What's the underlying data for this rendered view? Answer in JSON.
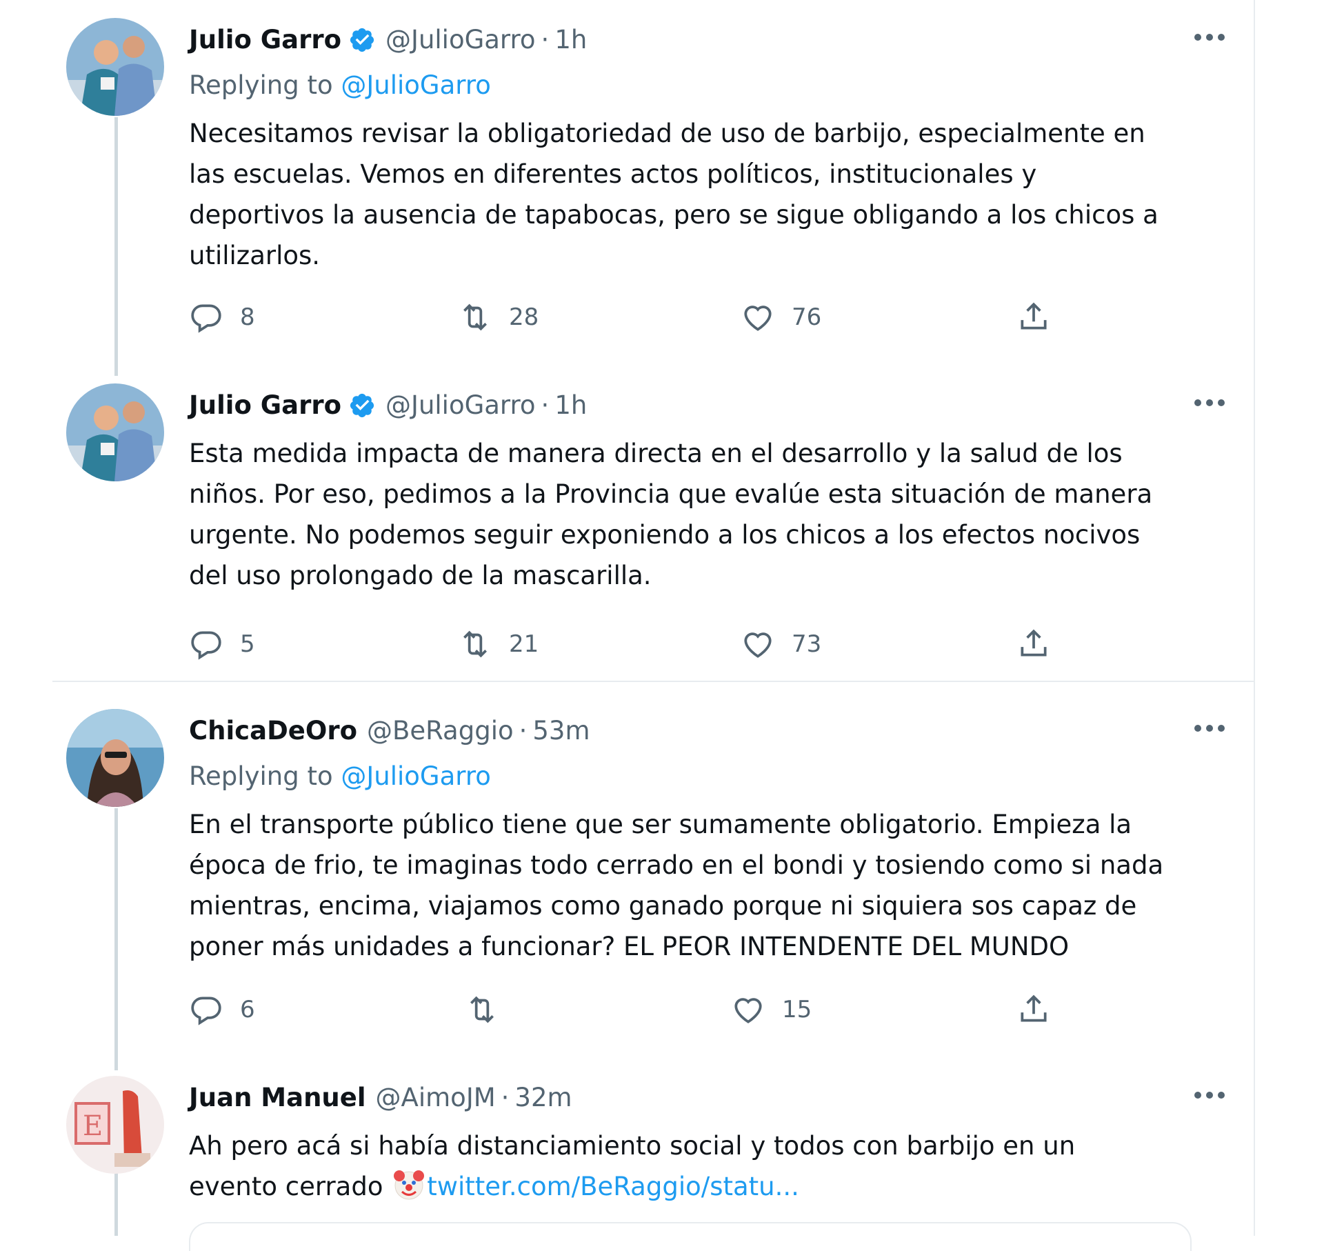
{
  "tweets": [
    {
      "name": "Julio Garro",
      "verified": true,
      "handle": "@JulioGarro",
      "time": "1h",
      "replying_label": "Replying to",
      "replying_to": "@JulioGarro",
      "text_lines": [
        "Necesitamos revisar la obligatoriedad de uso de barbijo, especialmente en",
        "las escuelas. Vemos en diferentes actos políticos, institucionales y",
        "deportivos la ausencia de tapabocas, pero se sigue obligando a los chicos a",
        "utilizarlos."
      ],
      "replies": "8",
      "retweets": "28",
      "likes": "76"
    },
    {
      "name": "Julio Garro",
      "verified": true,
      "handle": "@JulioGarro",
      "time": "1h",
      "text_lines": [
        "Esta medida impacta de manera directa en el desarrollo y la salud de los",
        "niños. Por eso, pedimos a la Provincia que evalúe esta situación de manera",
        "urgente. No podemos seguir exponiendo a los chicos a los efectos nocivos",
        "del uso prolongado de la mascarilla."
      ],
      "replies": "5",
      "retweets": "21",
      "likes": "73"
    },
    {
      "name": "ChicaDeOro",
      "verified": false,
      "handle": "@BeRaggio",
      "time": "53m",
      "replying_label": "Replying to",
      "replying_to": "@JulioGarro",
      "text_lines": [
        "En el transporte público tiene que ser sumamente obligatorio. Empieza la",
        "época de frio, te imaginas todo cerrado en el bondi y tosiendo como si nada",
        "mientras, encima, viajamos como ganado porque ni siquiera sos capaz de",
        "poner más unidades a funcionar? EL PEOR INTENDENTE DEL MUNDO"
      ],
      "replies": "6",
      "retweets": "",
      "likes": "15"
    },
    {
      "name": "Juan Manuel",
      "verified": false,
      "handle": "@AimoJM",
      "time": "32m",
      "text_lines": [
        "Ah pero acá si había distanciamiento social y todos con barbijo en un"
      ],
      "last_line_text": "evento cerrado",
      "last_line_emoji": "clown-face-icon",
      "last_line_link": "twitter.com/BeRaggio/statu..."
    }
  ],
  "separator": "·",
  "icons": {
    "reply": "reply-icon",
    "retweet": "retweet-icon",
    "like": "heart-icon",
    "share": "share-icon",
    "more": "more-icon",
    "verified": "verified-badge-icon"
  },
  "colors": {
    "link": "#1d9bf0",
    "secondary": "#536471",
    "text": "#0f1419",
    "border": "#e8ecef",
    "thread_line": "#cfd9de"
  }
}
